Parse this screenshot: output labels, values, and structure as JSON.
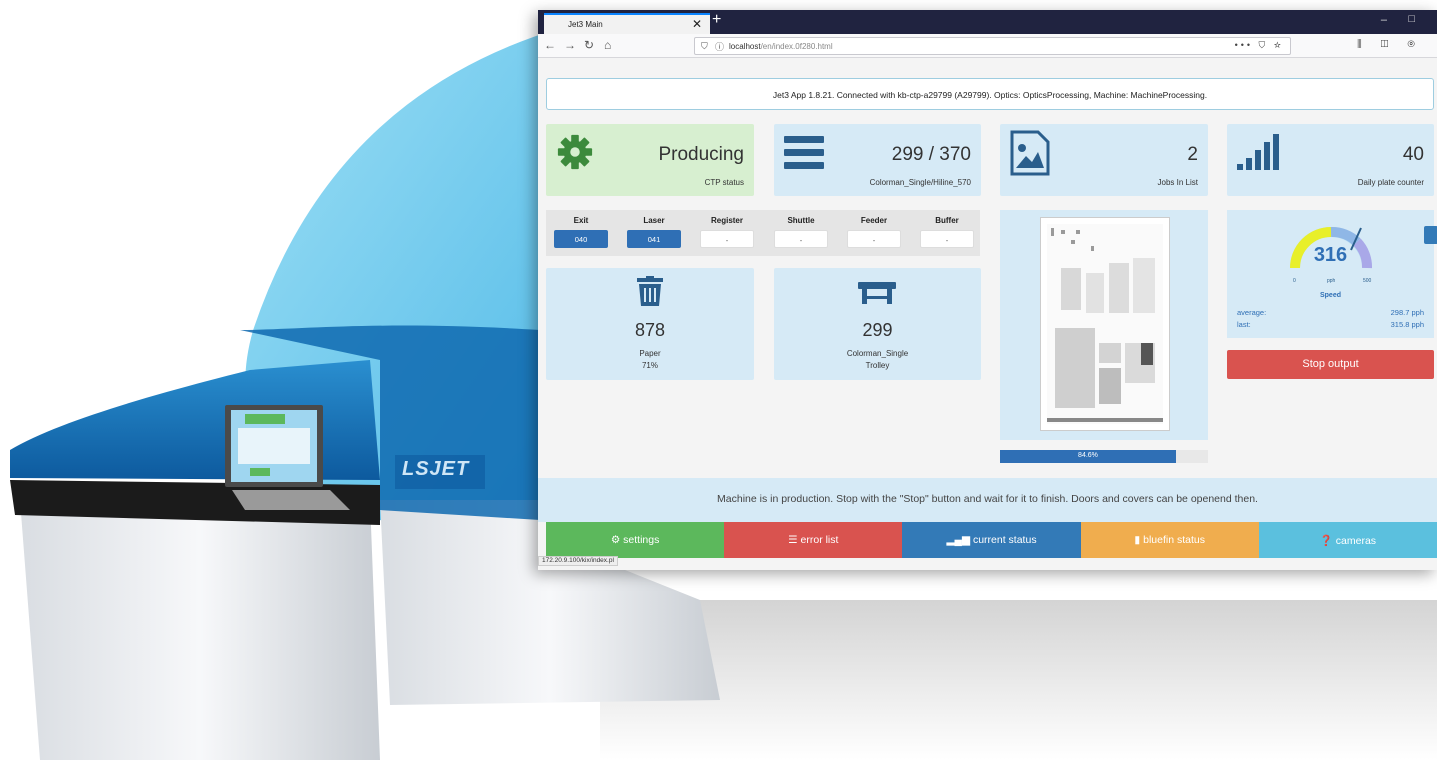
{
  "brand": {
    "machine_logo": "LSJET"
  },
  "browser": {
    "tab_title": "Jet3 Main",
    "new_tab_symbol": "+",
    "url_host": "localhost",
    "url_path": "/en/index.0f280.html",
    "page_actions": "••• ⛉ ☆",
    "toolbar_icons": "⫼ ◫ ⊚"
  },
  "app": {
    "info_text": "Jet3 App 1.8.21. Connected with kb-ctp-a29799 (A29799). Optics: OpticsProcessing, Machine: MachineProcessing.",
    "ctp_status": {
      "value": "Producing",
      "label": "CTP status"
    },
    "queue": {
      "value": "299 / 370",
      "label": "Colorman_Single/Hiline_570"
    },
    "jobs": {
      "value": "2",
      "label": "Jobs In List"
    },
    "daily": {
      "value": "40",
      "label": "Daily plate counter"
    },
    "positions": [
      {
        "label": "Exit",
        "value": "040",
        "active": true
      },
      {
        "label": "Laser",
        "value": "041",
        "active": true
      },
      {
        "label": "Register",
        "value": "-",
        "active": false
      },
      {
        "label": "Shuttle",
        "value": "-",
        "active": false
      },
      {
        "label": "Feeder",
        "value": "-",
        "active": false
      },
      {
        "label": "Buffer",
        "value": "-",
        "active": false
      }
    ],
    "paper": {
      "value": "878",
      "label": "Paper",
      "percent": "71%"
    },
    "trolley": {
      "value": "299",
      "label": "Colorman_Single",
      "sublabel": "Trolley"
    },
    "progress": {
      "text": "84.6%",
      "fraction": 0.846
    },
    "speed": {
      "value": "316",
      "label": "Speed",
      "gauge_min": "0",
      "gauge_unit": "pph",
      "gauge_max": "500",
      "average_label": "average:",
      "average_value": "298.7 pph",
      "last_label": "last:",
      "last_value": "315.8 pph"
    },
    "stop_button": "Stop output",
    "message": "Machine is in production. Stop with the \"Stop\" button and wait for it to finish. Doors and covers can be openend then.",
    "nav": [
      {
        "label": "settings",
        "icon": "gear-icon",
        "color": "#5cb85c"
      },
      {
        "label": "error list",
        "icon": "list-icon",
        "color": "#d9534f"
      },
      {
        "label": "current status",
        "icon": "signal-icon",
        "color": "#337ab7"
      },
      {
        "label": "bluefin status",
        "icon": "file-icon",
        "color": "#f0ad4e"
      },
      {
        "label": "cameras",
        "icon": "question-icon",
        "color": "#5bc0de"
      }
    ],
    "status_url": "172.20.9.100/kix/index.pl"
  }
}
